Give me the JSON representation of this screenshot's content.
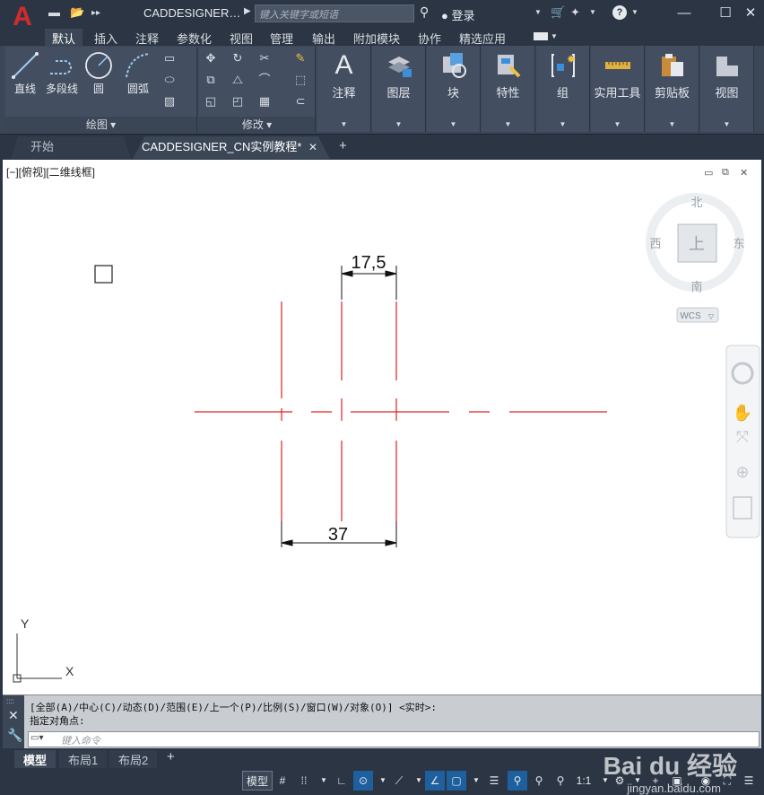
{
  "titlebar": {
    "app_letter": "A",
    "title": "CADDESIGNER…",
    "search_placeholder": "键入关键字或短语",
    "user_label": "登录"
  },
  "ribbon_tabs": [
    "默认",
    "插入",
    "注释",
    "参数化",
    "视图",
    "管理",
    "输出",
    "附加模块",
    "协作",
    "精选应用"
  ],
  "draw_panel": {
    "tools": [
      "直线",
      "多段线",
      "圆",
      "圆弧"
    ],
    "footer": "绘图"
  },
  "modify_panel": {
    "footer": "修改"
  },
  "big_tools": [
    "注释",
    "图层",
    "块",
    "特性",
    "组",
    "实用工具",
    "剪贴板",
    "视图"
  ],
  "doc_tabs": {
    "start": "开始",
    "active": "CADDESIGNER_CN实例教程*"
  },
  "canvas": {
    "viewport_label": "[−][俯视][二维线框]",
    "dimension_top": "17,5",
    "dimension_bottom": "37",
    "ucs_y": "Y",
    "ucs_x": "X",
    "line_color": "#e02020"
  },
  "viewcube": {
    "north": "北",
    "south": "南",
    "east": "东",
    "west": "西",
    "top": "上",
    "wcs": "WCS"
  },
  "command": {
    "line1": "[全部(A)/中心(C)/动态(D)/范围(E)/上一个(P)/比例(S)/窗口(W)/对象(O)] <实时>:",
    "line2": "指定对角点:",
    "input_placeholder": "键入命令"
  },
  "layout_tabs": [
    "模型",
    "布局1",
    "布局2"
  ],
  "statusbar": {
    "model": "模型",
    "scale": "1:1"
  },
  "watermark": {
    "brand": "Bai du 经验",
    "url": "jingyan.baidu.com"
  }
}
